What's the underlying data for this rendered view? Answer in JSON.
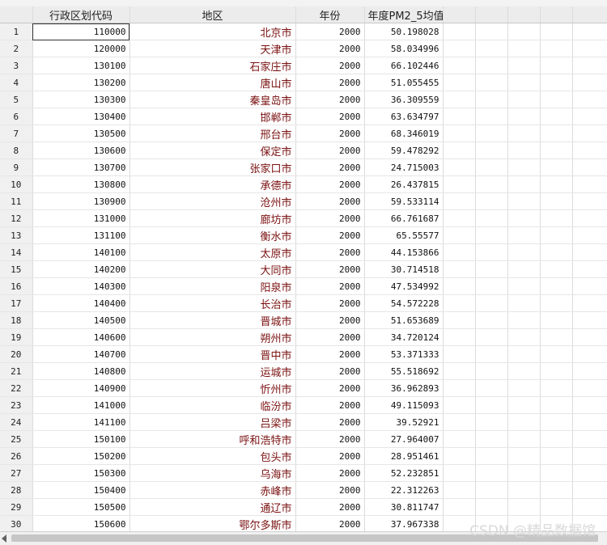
{
  "columns": {
    "rownum": "",
    "code": "行政区划代码",
    "region": "地区",
    "year": "年份",
    "pm": "年度PM2_5均值"
  },
  "rows": [
    {
      "n": "1",
      "code": "110000",
      "region": "北京市",
      "year": "2000",
      "pm": "50.198028"
    },
    {
      "n": "2",
      "code": "120000",
      "region": "天津市",
      "year": "2000",
      "pm": "58.034996"
    },
    {
      "n": "3",
      "code": "130100",
      "region": "石家庄市",
      "year": "2000",
      "pm": "66.102446"
    },
    {
      "n": "4",
      "code": "130200",
      "region": "唐山市",
      "year": "2000",
      "pm": "51.055455"
    },
    {
      "n": "5",
      "code": "130300",
      "region": "秦皇岛市",
      "year": "2000",
      "pm": "36.309559"
    },
    {
      "n": "6",
      "code": "130400",
      "region": "邯郸市",
      "year": "2000",
      "pm": "63.634797"
    },
    {
      "n": "7",
      "code": "130500",
      "region": "邢台市",
      "year": "2000",
      "pm": "68.346019"
    },
    {
      "n": "8",
      "code": "130600",
      "region": "保定市",
      "year": "2000",
      "pm": "59.478292"
    },
    {
      "n": "9",
      "code": "130700",
      "region": "张家口市",
      "year": "2000",
      "pm": "24.715003"
    },
    {
      "n": "10",
      "code": "130800",
      "region": "承德市",
      "year": "2000",
      "pm": "26.437815"
    },
    {
      "n": "11",
      "code": "130900",
      "region": "沧州市",
      "year": "2000",
      "pm": "59.533114"
    },
    {
      "n": "12",
      "code": "131000",
      "region": "廊坊市",
      "year": "2000",
      "pm": "66.761687"
    },
    {
      "n": "13",
      "code": "131100",
      "region": "衡水市",
      "year": "2000",
      "pm": "65.55577"
    },
    {
      "n": "14",
      "code": "140100",
      "region": "太原市",
      "year": "2000",
      "pm": "44.153866"
    },
    {
      "n": "15",
      "code": "140200",
      "region": "大同市",
      "year": "2000",
      "pm": "30.714518"
    },
    {
      "n": "16",
      "code": "140300",
      "region": "阳泉市",
      "year": "2000",
      "pm": "47.534992"
    },
    {
      "n": "17",
      "code": "140400",
      "region": "长治市",
      "year": "2000",
      "pm": "54.572228"
    },
    {
      "n": "18",
      "code": "140500",
      "region": "晋城市",
      "year": "2000",
      "pm": "51.653689"
    },
    {
      "n": "19",
      "code": "140600",
      "region": "朔州市",
      "year": "2000",
      "pm": "34.720124"
    },
    {
      "n": "20",
      "code": "140700",
      "region": "晋中市",
      "year": "2000",
      "pm": "53.371333"
    },
    {
      "n": "21",
      "code": "140800",
      "region": "运城市",
      "year": "2000",
      "pm": "55.518692"
    },
    {
      "n": "22",
      "code": "140900",
      "region": "忻州市",
      "year": "2000",
      "pm": "36.962893"
    },
    {
      "n": "23",
      "code": "141000",
      "region": "临汾市",
      "year": "2000",
      "pm": "49.115093"
    },
    {
      "n": "24",
      "code": "141100",
      "region": "吕梁市",
      "year": "2000",
      "pm": "39.52921"
    },
    {
      "n": "25",
      "code": "150100",
      "region": "呼和浩特市",
      "year": "2000",
      "pm": "27.964007"
    },
    {
      "n": "26",
      "code": "150200",
      "region": "包头市",
      "year": "2000",
      "pm": "28.951461"
    },
    {
      "n": "27",
      "code": "150300",
      "region": "乌海市",
      "year": "2000",
      "pm": "52.232851"
    },
    {
      "n": "28",
      "code": "150400",
      "region": "赤峰市",
      "year": "2000",
      "pm": "22.312263"
    },
    {
      "n": "29",
      "code": "150500",
      "region": "通辽市",
      "year": "2000",
      "pm": "30.811747"
    },
    {
      "n": "30",
      "code": "150600",
      "region": "鄂尔多斯市",
      "year": "2000",
      "pm": "37.967338"
    }
  ],
  "watermark": "CSDN @精品数据馆",
  "colors": {
    "region_text": "#7a1010",
    "header_bg": "#ececec",
    "rownum_bg": "#f0f0f0"
  }
}
